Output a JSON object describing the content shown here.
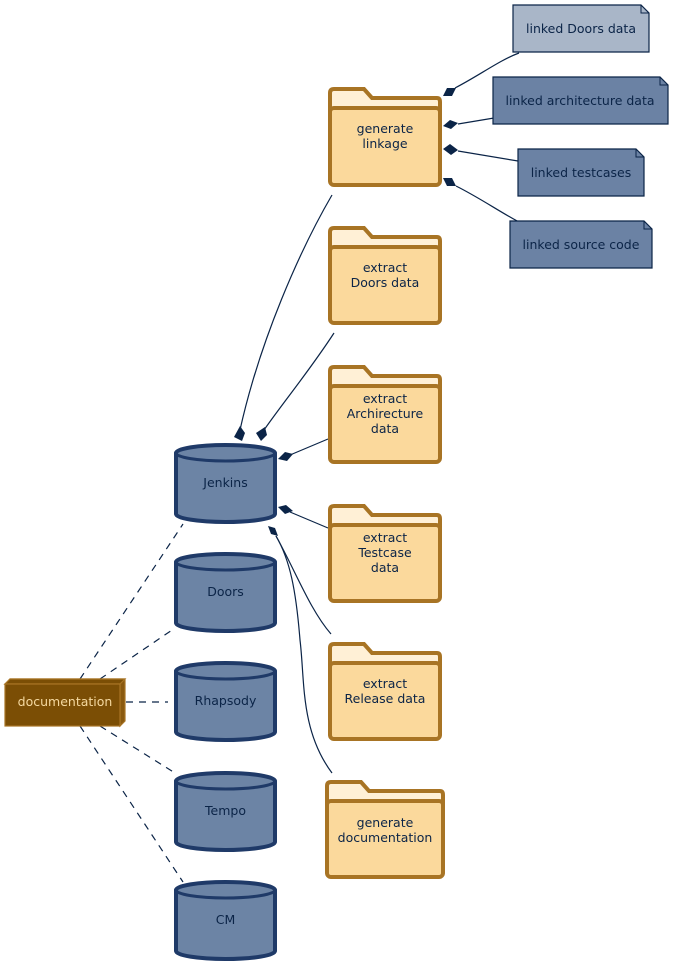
{
  "colors": {
    "folder_fill": "#fbd99c",
    "folder_tab": "#fff0d6",
    "folder_stroke": "#a87424",
    "db_fill": "#6c84a5",
    "db_stroke": "#1f3a68",
    "note_light": "#a9b6c8",
    "note_dark": "#6b82a4",
    "doc_fill": "#7b4e05",
    "edge": "#0b2447"
  },
  "folders": [
    {
      "lines": [
        "generate",
        "linkage"
      ]
    },
    {
      "lines": [
        "extract",
        "Doors data"
      ]
    },
    {
      "lines": [
        "extract",
        "Archirecture",
        "data"
      ]
    },
    {
      "lines": [
        "extract",
        "Testcase",
        "data"
      ]
    },
    {
      "lines": [
        "extract",
        "Release data"
      ]
    },
    {
      "lines": [
        "generate",
        "documentation"
      ]
    }
  ],
  "notes": [
    "linked Doors data",
    "linked architecture data",
    "linked testcases",
    "linked source code"
  ],
  "databases": [
    "Jenkins",
    "Doors",
    "Rhapsody",
    "Tempo",
    "CM"
  ],
  "node": {
    "label": "documentation"
  }
}
